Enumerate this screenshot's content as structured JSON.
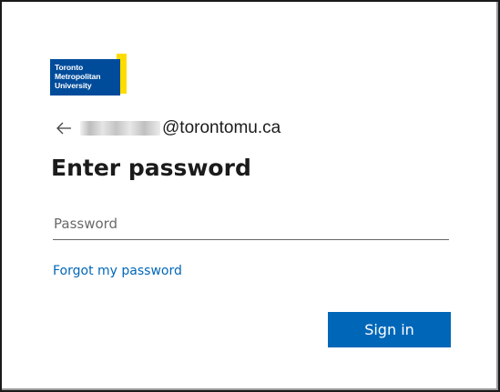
{
  "logo": {
    "lines": [
      "Toronto",
      "Metropolitan",
      "University"
    ],
    "colors": {
      "blue": "#004c9b",
      "yellow": "#ffdc00"
    }
  },
  "identity": {
    "back_icon": "arrow-left-icon",
    "email_domain": "@torontomu.ca"
  },
  "title": "Enter password",
  "password_field": {
    "placeholder": "Password",
    "value": ""
  },
  "forgot_link": "Forgot my password",
  "sign_in_button": "Sign in",
  "colors": {
    "accent": "#0067b8",
    "text": "#1b1b1b"
  }
}
